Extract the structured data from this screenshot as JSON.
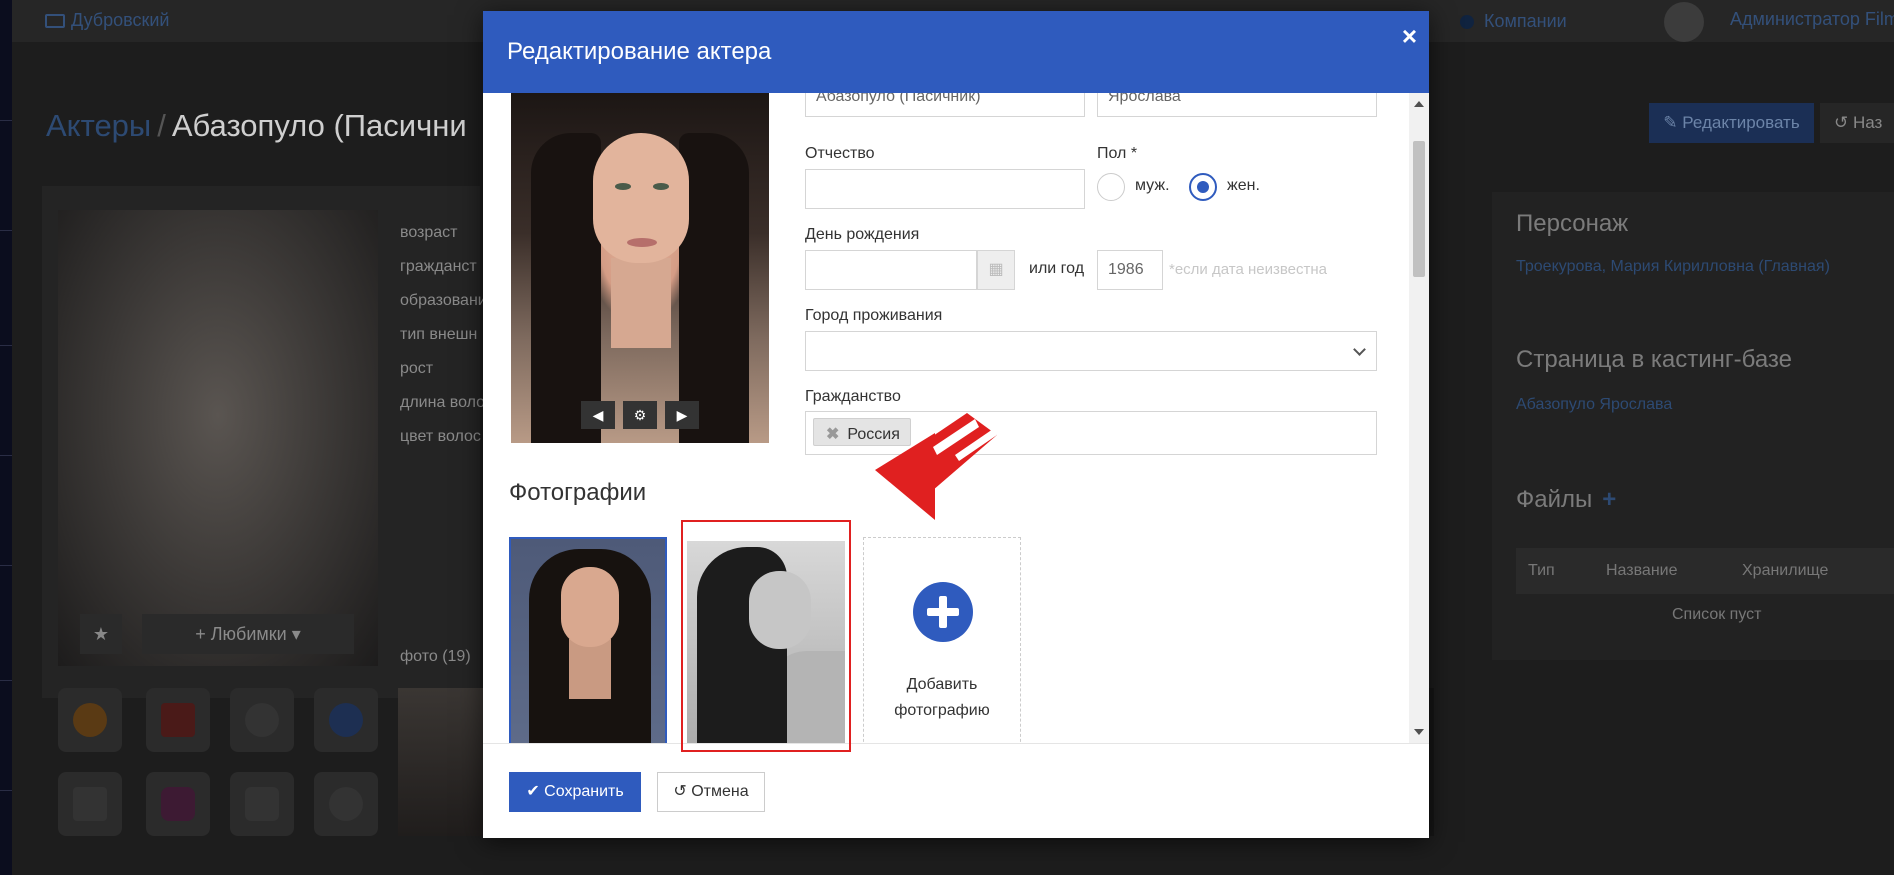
{
  "background": {
    "brand": "Дубровский",
    "companies": "Компании",
    "user": "Администратор Film",
    "breadcrumb": {
      "root": "Актеры",
      "separator": "/",
      "current": "Абазопуло (Пасични"
    },
    "favorites_label": "Любимки",
    "props": [
      "возраст",
      "гражданст",
      "образовани",
      "тип внешн",
      "рост",
      "длина воло",
      "цвет волос"
    ],
    "foto_count": "фото (19)",
    "edit_label": "Редактировать",
    "back_label": "Наз",
    "right": {
      "character_title": "Персонаж",
      "character_link": "Троекурова, Мария Кирилловна (Главная)",
      "casting_title": "Страница в кастинг-базе",
      "casting_link": "Абазопуло Ярослава",
      "files_title": "Файлы",
      "files_columns": [
        "Тип",
        "Название",
        "Хранилище"
      ],
      "files_empty": "Список пуст"
    }
  },
  "modal": {
    "title": "Редактирование актера",
    "close_symbol": "×",
    "surname_value": "Абазопуло (Пасичник)",
    "name_value": "Ярослава",
    "patronymic_label": "Отчество",
    "patronymic_value": "",
    "gender_label": "Пол *",
    "gender_male": "муж.",
    "gender_female": "жен.",
    "gender_selected": "жен.",
    "birthday_label": "День рождения",
    "birthday_value": "",
    "or_year_label": "или год",
    "year_value": "1986",
    "year_hint": "*если дата неизвестна",
    "city_label": "Город проживания",
    "city_value": "",
    "citizenship_label": "Гражданство",
    "citizenship_tags": [
      "Россия"
    ],
    "photos_title": "Фотографии",
    "add_photo_line1": "Добавить",
    "add_photo_line2": "фотографию",
    "save_label": "Сохранить",
    "cancel_label": "Отмена"
  },
  "colors": {
    "primary": "#2f5bbe",
    "annotation_red": "#e02020"
  }
}
